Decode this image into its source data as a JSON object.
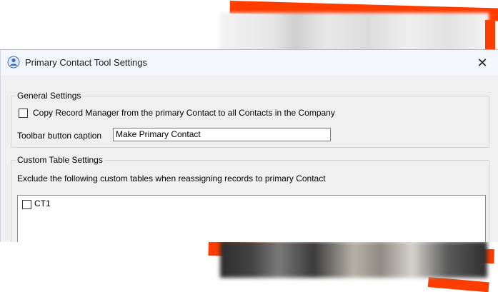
{
  "window": {
    "title": "Primary Contact Tool Settings",
    "close_glyph": "✕"
  },
  "general_settings": {
    "legend": "General Settings",
    "copy_record_manager": {
      "label": "Copy Record Manager from the primary Contact to all Contacts  in the Company",
      "checked": false
    },
    "toolbar_caption": {
      "label": "Toolbar button caption",
      "value": "Make Primary Contact"
    }
  },
  "custom_table_settings": {
    "legend": "Custom Table Settings",
    "description": "Exclude the following custom tables when reassigning records to primary Contact",
    "tables": [
      {
        "label": "CT1",
        "checked": false
      }
    ]
  },
  "icons": {
    "app_icon": "people-icon",
    "close_icon": "close-icon"
  },
  "colors": {
    "accent_stripe": "#ff3d00",
    "dialog_bg": "#f0f0f0",
    "titlebar_bg": "#f3f6fa"
  }
}
